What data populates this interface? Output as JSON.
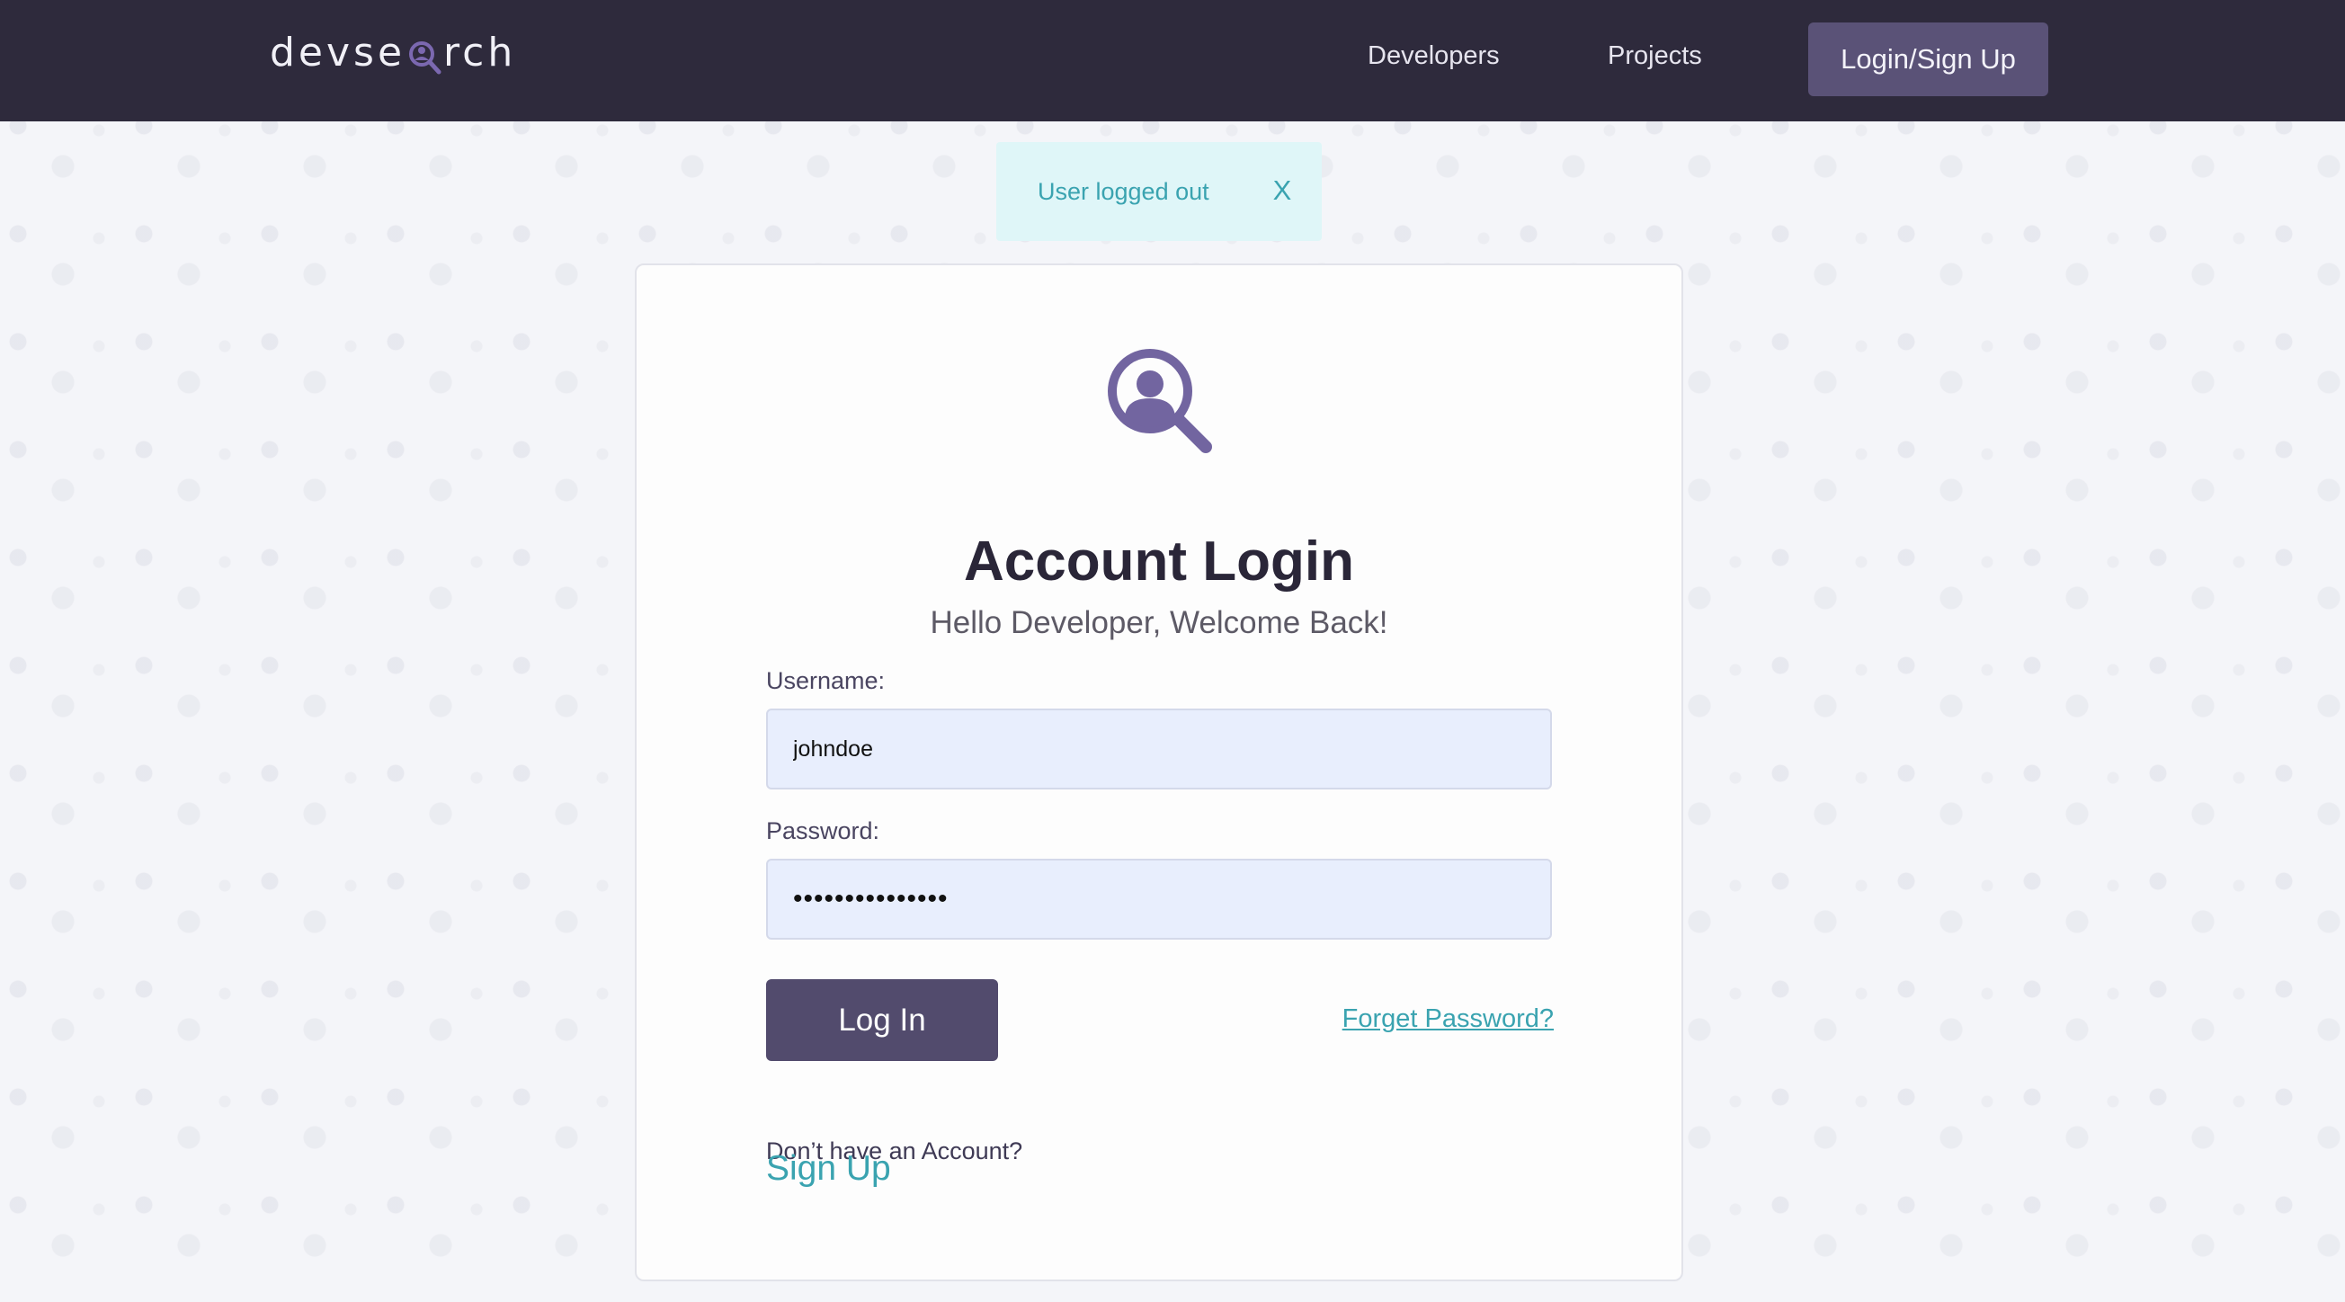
{
  "nav": {
    "logo": {
      "prefix": "devse",
      "suffix": "rch"
    },
    "links": [
      {
        "label": "Developers"
      },
      {
        "label": "Projects"
      }
    ],
    "login_label": "Login/Sign Up"
  },
  "flash": {
    "message": "User logged out",
    "close_label": "X",
    "color": "#3aa3b0"
  },
  "login": {
    "title": "Account Login",
    "subtitle": "Hello Developer, Welcome Back!",
    "username_label": "Username:",
    "username_value": "johndoe",
    "password_label": "Password:",
    "password_value": "•••••••••••••••",
    "submit_label": "Log In",
    "forgot_label": "Forget Password?",
    "no_account_text": "Don’t have an Account?",
    "signup_label": "Sign Up"
  },
  "colors": {
    "navbar": "#2e2a3c",
    "accent": "#5a5277",
    "link": "#3aa3b0",
    "input_bg": "#e8eefd"
  },
  "icons": {
    "logo_mark": "user-search-icon",
    "card_icon": "user-search-icon"
  }
}
